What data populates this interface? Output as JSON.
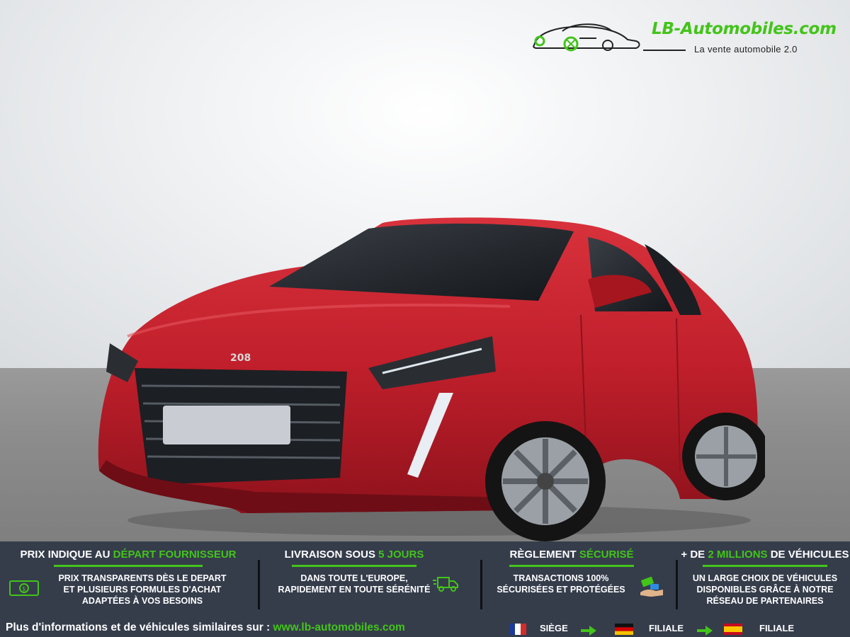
{
  "logo": {
    "brand": "LB-Automobiles.com",
    "tagline": "La vente automobile 2.0"
  },
  "car": {
    "badge": "208",
    "color": "#c01f2b"
  },
  "features": [
    {
      "title_pre": "PRIX INDIQUE AU ",
      "title_accent": "DÉPART FOURNISSEUR",
      "title_post": "",
      "lines": [
        "PRIX TRANSPARENTS DÈS LE DEPART",
        "ET PLUSIEURS FORMULES D'ACHAT",
        "ADAPTÉES À VOS BESOINS"
      ]
    },
    {
      "title_pre": "LIVRAISON SOUS ",
      "title_accent": "5 JOURS",
      "title_post": "",
      "lines": [
        "DANS TOUTE L'EUROPE,",
        "RAPIDEMENT EN TOUTE SÉRÉNITÉ"
      ]
    },
    {
      "title_pre": "RÈGLEMENT ",
      "title_accent": "SÉCURISÉ",
      "title_post": "",
      "lines": [
        "TRANSACTIONS 100%",
        "SÉCURISÉES ET PROTÉGÉES"
      ]
    },
    {
      "title_pre": "+ DE ",
      "title_accent": "2 MILLIONS",
      "title_post": " DE VÉHICULES",
      "lines": [
        "UN LARGE CHOIX DE VÉHICULES",
        "DISPONIBLES GRÂCE À NOTRE",
        "RÉSEAU DE PARTENAIRES"
      ]
    }
  ],
  "footer": {
    "text": "Plus d'informations et de véhicules similaires sur : ",
    "url": "www.lb-automobiles.com",
    "locations": [
      {
        "flag": "france-flag",
        "label": "SIÈGE"
      },
      {
        "flag": "germany-flag",
        "label": "FILIALE"
      },
      {
        "flag": "spain-flag",
        "label": "FILIALE"
      }
    ]
  },
  "colors": {
    "accent": "#43c41a",
    "band": "#353d4b"
  }
}
